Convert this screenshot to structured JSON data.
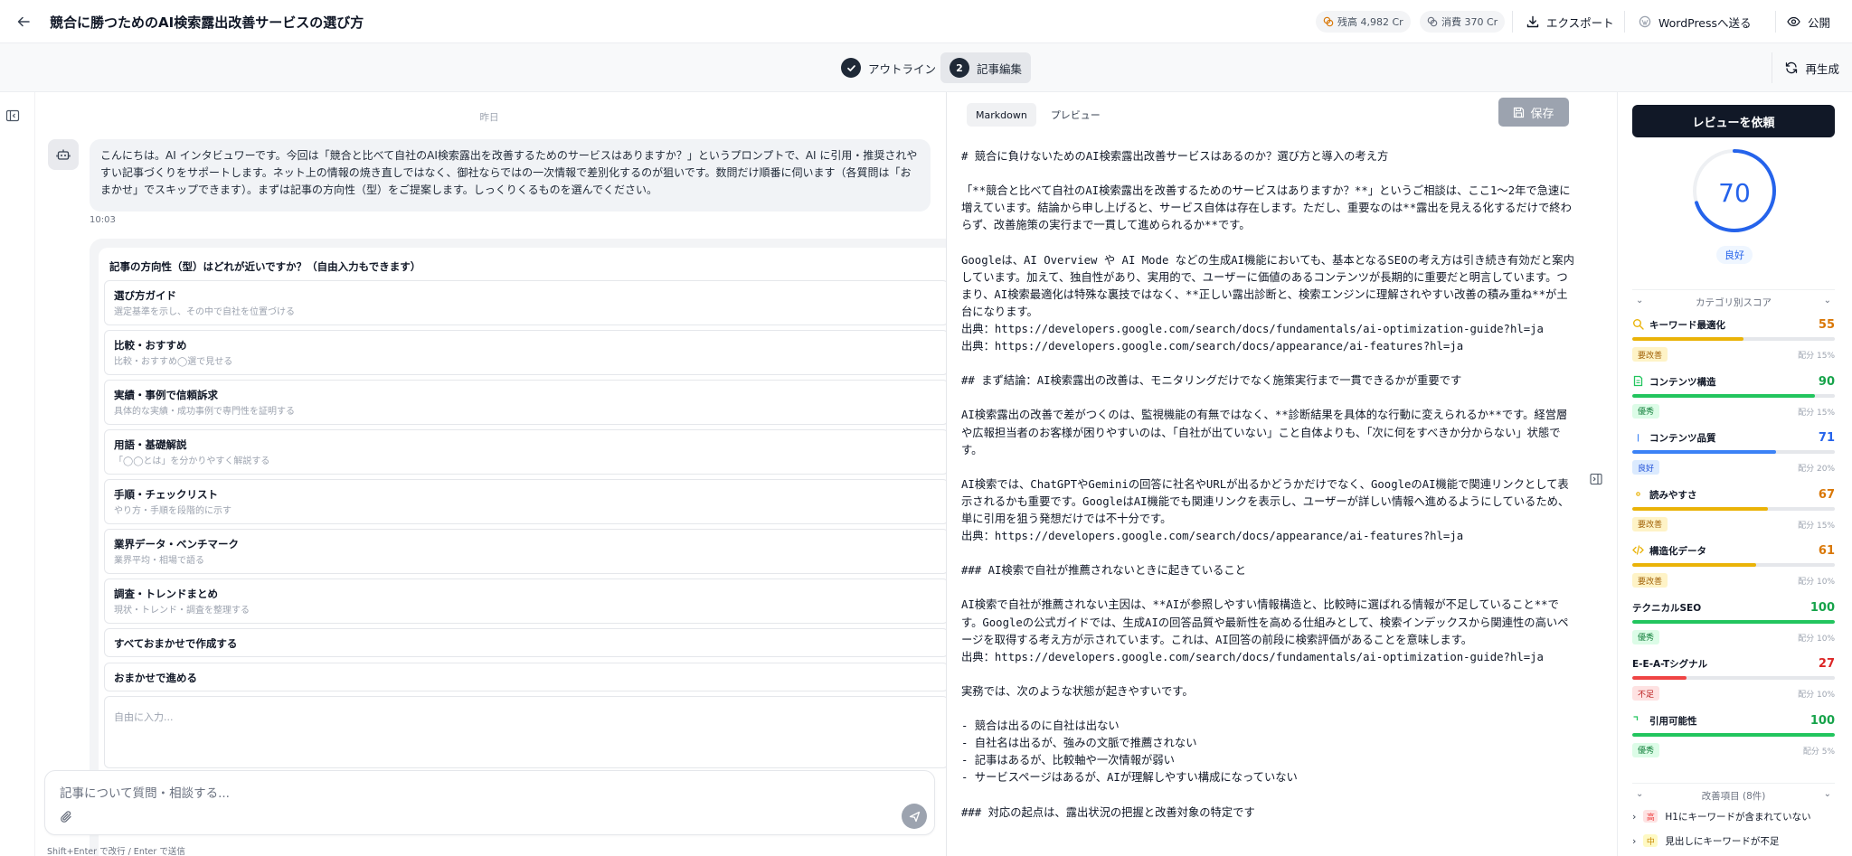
{
  "header": {
    "title": "競合に勝つためのAI検索露出改善サービスの選び方",
    "balance": "残高 4,982 Cr",
    "consumed": "消費 370 Cr",
    "export_label": "エクスポート",
    "wordpress_label": "WordPressへ送る",
    "publish_label": "公開"
  },
  "steps": {
    "outline_label": "アウトライン",
    "edit_number": "2",
    "edit_label": "記事編集",
    "regenerate_label": "再生成"
  },
  "chat": {
    "date_label": "昨日",
    "message": "こんにちは。AI インタビュワーです。今回は「競合と比べて自社のAI検索露出を改善するためのサービスはありますか？」というプロンプトで、AI に引用・推奨されやすい記事づくりをサポートします。ネット上の情報の焼き直しではなく、御社ならではの一次情報で差別化するのが狙いです。数問だけ順番に伺います（各質問は「おまかせ」でスキップできます）。まずは記事の方向性（型）をご提案します。しっくりくるものを選んでください。",
    "time": "10:03",
    "question_title": "記事の方向性（型）はどれが近いですか？（自由入力もできます）",
    "options": [
      {
        "label": "選び方ガイド",
        "desc": "選定基準を示し、その中で自社を位置づける"
      },
      {
        "label": "比較・おすすめ",
        "desc": "比較・おすすめ◯選で見せる"
      },
      {
        "label": "実績・事例で信頼訴求",
        "desc": "具体的な実績・成功事例で専門性を証明する"
      },
      {
        "label": "用語・基礎解説",
        "desc": "「◯◯とは」を分かりやすく解説する"
      },
      {
        "label": "手順・チェックリスト",
        "desc": "やり方・手順を段階的に示す"
      },
      {
        "label": "業界データ・ベンチマーク",
        "desc": "業界平均・相場で語る"
      },
      {
        "label": "調査・トレンドまとめ",
        "desc": "現状・トレンド・調査を整理する"
      },
      {
        "label": "すべておまかせで作成する",
        "desc": ""
      },
      {
        "label": "おまかせで進める",
        "desc": ""
      }
    ],
    "free_input_placeholder": "自由に入力...",
    "input_placeholder": "記事について質問・相談する...",
    "hint": "Shift+Enter で改行 / Enter で送信"
  },
  "editor": {
    "tab_markdown": "Markdown",
    "tab_preview": "プレビュー",
    "save_label": "保存",
    "paragraphs": [
      "# 競合に負けないためのAI検索露出改善サービスはあるのか？選び方と導入の考え方",
      "",
      "「**競合と比べて自社のAI検索露出を改善するためのサービスはありますか？**」というご相談は、ここ1～2年で急速に増えています。結論から申し上げると、サービス自体は存在します。ただし、重要なのは**露出を見える化するだけで終わらず、改善施策の実行まで一貫して進められるか**です。",
      "",
      "Googleは、AI Overview や AI Mode などの生成AI機能においても、基本となるSEOの考え方は引き続き有効だと案内しています。加えて、独自性があり、実用的で、ユーザーに価値のあるコンテンツが長期的に重要だと明言しています。つまり、AI検索最適化は特殊な裏技ではなく、**正しい露出診断と、検索エンジンに理解されやすい改善の積み重ね**が土台になります。",
      "出典：https://developers.google.com/search/docs/fundamentals/ai-optimization-guide?hl=ja",
      "出典：https://developers.google.com/search/docs/appearance/ai-features?hl=ja",
      "",
      "## まず結論：AI検索露出の改善は、モニタリングだけでなく施策実行まで一貫できるかが重要です",
      "",
      "AI検索露出の改善で差がつくのは、監視機能の有無ではなく、**診断結果を具体的な行動に変えられるか**です。経営層や広報担当者のお客様が困りやすいのは、「自社が出ていない」こと自体よりも、「次に何をすべきか分からない」状態です。",
      "",
      "AI検索では、ChatGPTやGeminiの回答に社名やURLが出るかどうかだけでなく、GoogleのAI機能で関連リンクとして表示されるかも重要です。GoogleはAI機能でも関連リンクを表示し、ユーザーが詳しい情報へ進めるようにしているため、単に引用を狙う発想だけでは不十分です。",
      "出典：https://developers.google.com/search/docs/appearance/ai-features?hl=ja",
      "",
      "### AI検索で自社が推薦されないときに起きていること",
      "",
      "AI検索で自社が推薦されない主因は、**AIが参照しやすい情報構造と、比較時に選ばれる情報が不足していること**です。Googleの公式ガイドでは、生成AIの回答品質や最新性を高める仕組みとして、検索インデックスから関連性の高いページを取得する考え方が示されています。これは、AI回答の前段に検索評価があることを意味します。",
      "出典：https://developers.google.com/search/docs/fundamentals/ai-optimization-guide?hl=ja",
      "",
      "実務では、次のような状態が起きやすいです。",
      "",
      "- 競合は出るのに自社は出ない",
      "- 自社名は出るが、強みの文脈で推薦されない",
      "- 記事はあるが、比較軸や一次情報が弱い",
      "- サービスページはあるが、AIが理解しやすい構成になっていない",
      "",
      "### 対応の起点は、露出状況の把握と改善対象の特定です"
    ]
  },
  "review": {
    "button_label": "レビューを依頼",
    "score": 70,
    "score_label": "良好",
    "category_header": "カテゴリ別スコア",
    "categories": [
      {
        "name": "キーワード最適化",
        "score": 55,
        "status": "要改善",
        "weight": "配分 15%",
        "icon": "search-icon",
        "color": "#eab308"
      },
      {
        "name": "コンテンツ構造",
        "score": 90,
        "status": "優秀",
        "weight": "配分 15%",
        "icon": "document-icon",
        "color": "#22c55e"
      },
      {
        "name": "コンテンツ品質",
        "score": 71,
        "status": "良好",
        "weight": "配分 20%",
        "icon": "book-icon",
        "color": "#3b82f6"
      },
      {
        "name": "読みやすさ",
        "score": 67,
        "status": "要改善",
        "weight": "配分 15%",
        "icon": "eye-icon",
        "color": "#eab308"
      },
      {
        "name": "構造化データ",
        "score": 61,
        "status": "要改善",
        "weight": "配分 10%",
        "icon": "code-icon",
        "color": "#eab308"
      },
      {
        "name": "テクニカルSEO",
        "score": 100,
        "status": "優秀",
        "weight": "配分 10%",
        "icon": "",
        "color": "#22c55e"
      },
      {
        "name": "E-E-A-Tシグナル",
        "score": 27,
        "status": "不足",
        "weight": "配分 10%",
        "icon": "",
        "color": "#ef4444"
      },
      {
        "name": "引用可能性",
        "score": 100,
        "status": "優秀",
        "weight": "配分 5%",
        "icon": "quote-icon",
        "color": "#22c55e"
      }
    ],
    "issues_header": "改善項目 (8件)",
    "issues": [
      {
        "priority": "高",
        "text": "H1にキーワードが含まれていない",
        "color": "#ef4444",
        "bg": "#fee2e2"
      },
      {
        "priority": "中",
        "text": "見出しにキーワードが不足",
        "color": "#ca8a04",
        "bg": "#fef9c3"
      }
    ]
  }
}
